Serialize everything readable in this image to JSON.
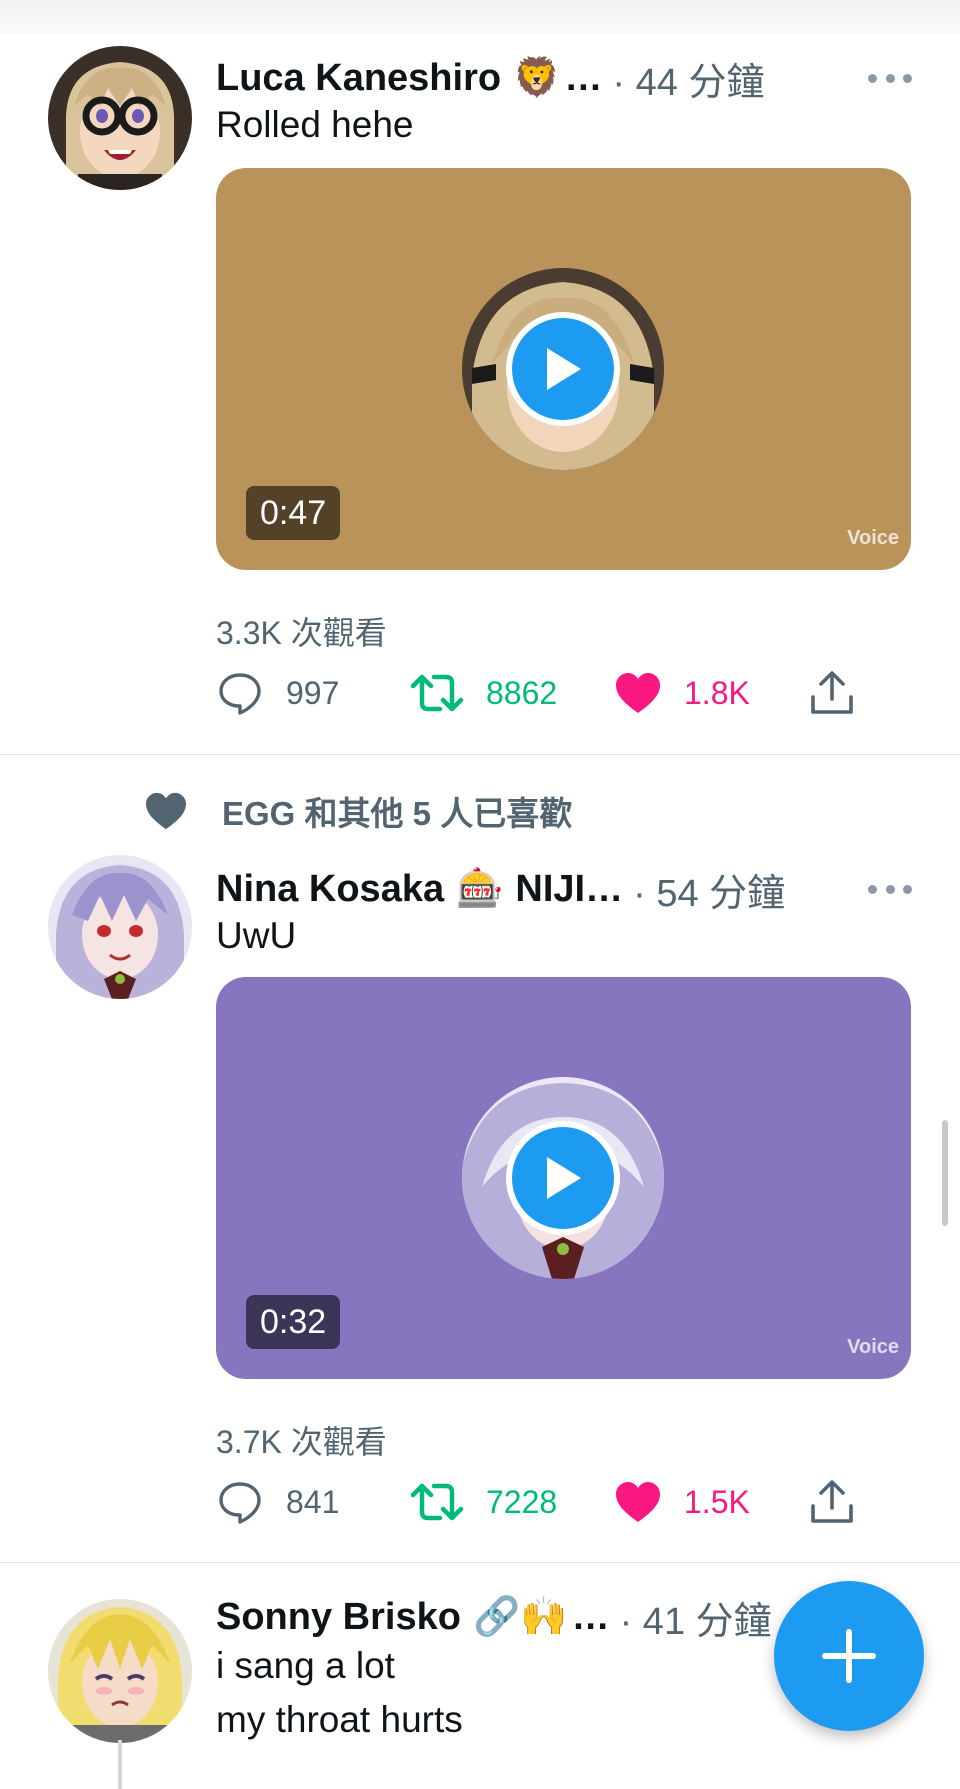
{
  "tweets": [
    {
      "author": "Luca Kaneshiro",
      "emoji": "🦁",
      "name_ellipsis": "…",
      "meta": "· 44 分鐘",
      "text": "Rolled hehe",
      "media": {
        "duration": "0:47",
        "watermark": "Voice",
        "background": "#b9935a"
      },
      "views": "3.3K 次觀看",
      "reply_count": "997",
      "retweet_count": "8862",
      "like_count": "1.8K"
    },
    {
      "social_context": "EGG 和其他 5 人已喜歡",
      "author": "Nina Kosaka",
      "emoji": "🎰",
      "name_suffix": "NIJI…",
      "meta": "· 54 分鐘",
      "text": "UwU",
      "media": {
        "duration": "0:32",
        "watermark": "Voice",
        "background": "#8775c0"
      },
      "views": "3.7K 次觀看",
      "reply_count": "841",
      "retweet_count": "7228",
      "like_count": "1.5K"
    },
    {
      "author": "Sonny Brisko",
      "emoji": "🔗🙌",
      "name_ellipsis": "…",
      "meta": "· 41 分鐘",
      "text_line1": "i sang a lot",
      "text_line2": "my throat hurts"
    }
  ],
  "colors": {
    "accent": "#1d9bf0",
    "retweet": "#00ba7c",
    "like": "#f91880",
    "secondary_text": "#536471"
  },
  "icons": {
    "reply": "speech-bubble-icon",
    "retweet": "retweet-arrows-icon",
    "like": "heart-filled-icon",
    "share": "share-upload-icon",
    "more": "ellipsis-icon",
    "compose": "plus-icon",
    "play": "play-icon"
  }
}
